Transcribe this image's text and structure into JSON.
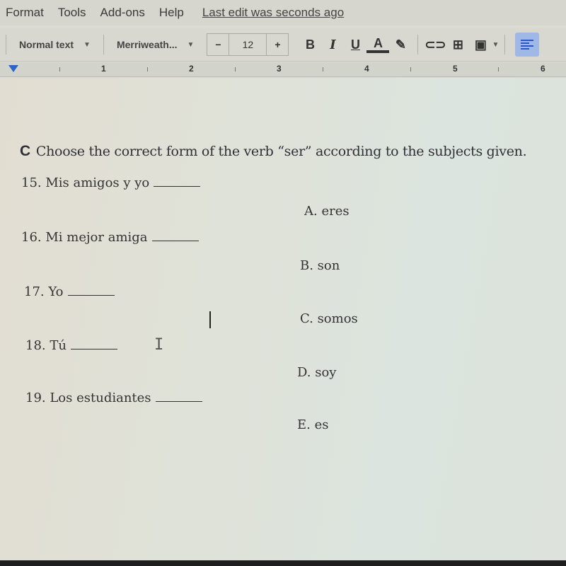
{
  "menubar": {
    "items": [
      "Format",
      "Tools",
      "Add-ons",
      "Help"
    ],
    "last_edit": "Last edit was seconds ago"
  },
  "toolbar": {
    "style_select": "Normal text",
    "font_select": "Merriweath...",
    "font_size": "12",
    "decrease_label": "−",
    "increase_label": "+",
    "bold": "B",
    "italic": "I",
    "underline": "U",
    "text_color": "A"
  },
  "ruler": {
    "numbers": [
      "1",
      "2",
      "3",
      "4",
      "5",
      "6"
    ]
  },
  "document": {
    "heading_letter": "C",
    "heading_text": "Choose the correct form of the verb “ser” according to the subjects given.",
    "questions": [
      "15. Mis amigos y yo",
      "16. Mi mejor amiga",
      "17. Yo",
      "18. Tú",
      "19. Los estudiantes"
    ],
    "options": [
      "A.  eres",
      "B. son",
      "C. somos",
      "D. soy",
      "E. es"
    ]
  }
}
